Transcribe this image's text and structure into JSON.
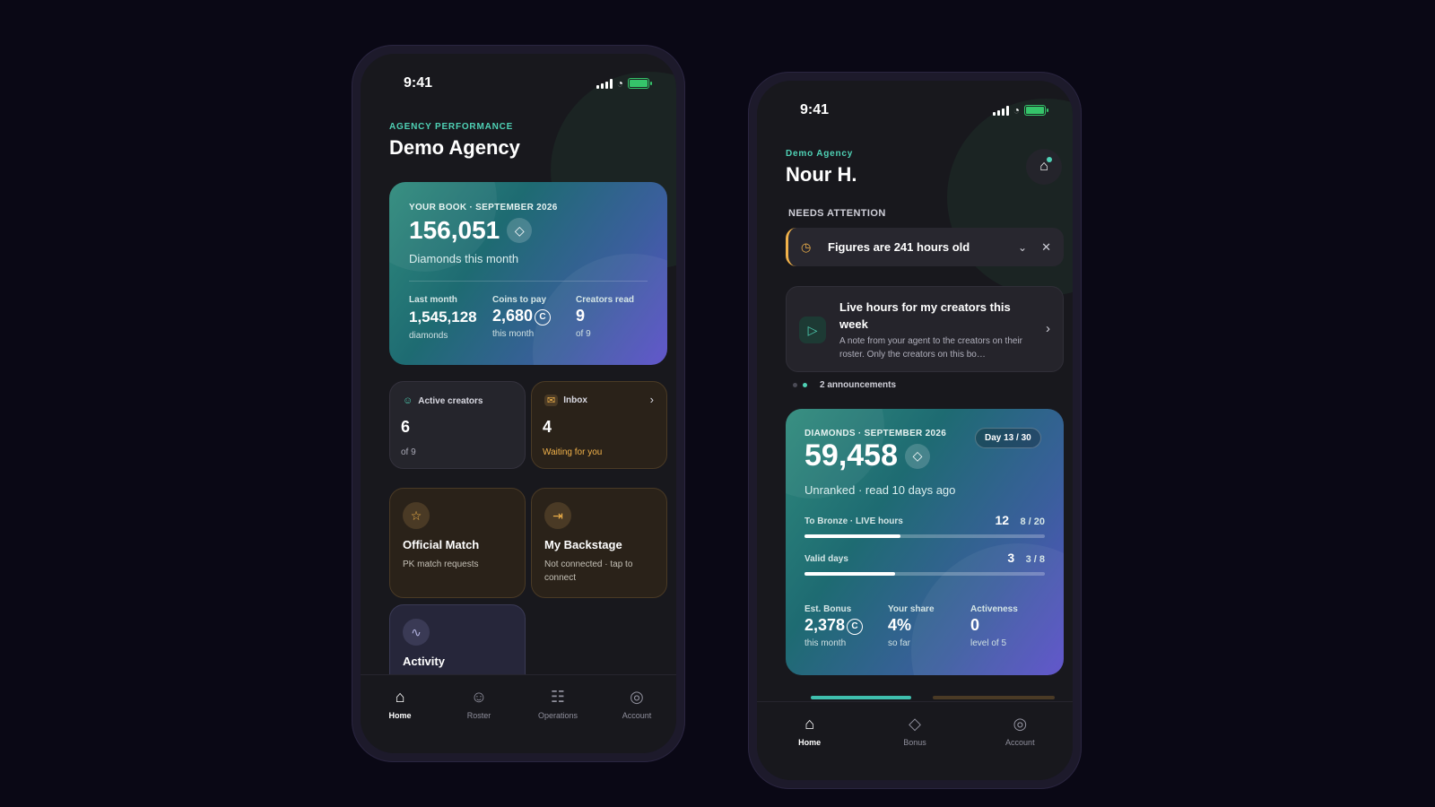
{
  "phone1": {
    "status_time": "9:41",
    "eyebrow": "AGENCY PERFORMANCE",
    "title": "Demo Agency",
    "hero": {
      "label": "YOUR BOOK · SEPTEMBER 2026",
      "value": "156,051",
      "subtitle": "Diamonds this month",
      "stats": [
        {
          "label": "Last month",
          "value": "1,545,128",
          "sub": "diamonds"
        },
        {
          "label": "Coins to pay",
          "value": "2,680",
          "sub": "this month"
        },
        {
          "label": "Creators read",
          "value": "9",
          "sub": "of 9"
        }
      ]
    },
    "active_creators": {
      "label": "Active creators",
      "value": "6",
      "sub": "of 9"
    },
    "inbox": {
      "label": "Inbox",
      "value": "4",
      "sub": "Waiting for you"
    },
    "official_match": {
      "title": "Official Match",
      "desc": "PK match requests"
    },
    "backstage": {
      "title": "My Backstage",
      "desc": "Not connected · tap to connect"
    },
    "activity": {
      "title": "Activity"
    },
    "tabs": [
      {
        "label": "Home",
        "icon": "home-icon"
      },
      {
        "label": "Roster",
        "icon": "users-icon"
      },
      {
        "label": "Operations",
        "icon": "grid-icon"
      },
      {
        "label": "Account",
        "icon": "account-icon"
      }
    ]
  },
  "phone2": {
    "status_time": "9:41",
    "eyebrow": "Demo Agency",
    "title": "Nour H.",
    "section_label": "NEEDS ATTENTION",
    "attention_text": "Figures are 241 hours old",
    "announcement": {
      "title": "Live hours for my creators this week",
      "body": "A note from your agent to the creators on their roster. Only the creators on this bo…",
      "count": "2 announcements"
    },
    "hero": {
      "label": "DIAMONDS · SEPTEMBER 2026",
      "value": "59,458",
      "day_pill": "Day 13 / 30",
      "subtitle": "Unranked · read 10 days ago",
      "progress": [
        {
          "label": "To Bronze · LIVE hours",
          "value": "12",
          "of": "8 / 20",
          "fraction": 0.4
        },
        {
          "label": "Valid days",
          "value": "3",
          "of": "3 / 8",
          "fraction": 0.375
        }
      ],
      "stats": [
        {
          "label": "Est. Bonus",
          "value": "2,378",
          "sub": "this month"
        },
        {
          "label": "Your share",
          "value": "4%",
          "sub": "so far"
        },
        {
          "label": "Activeness",
          "value": "0",
          "sub": "level of 5"
        }
      ]
    },
    "tabs": [
      {
        "label": "Home",
        "icon": "home-icon"
      },
      {
        "label": "Bonus",
        "icon": "diamond-icon"
      },
      {
        "label": "Account",
        "icon": "account-icon"
      }
    ]
  },
  "colors": {
    "accent": "#4fd1b5",
    "warning": "#f1b24a",
    "background": "#0a0815"
  }
}
